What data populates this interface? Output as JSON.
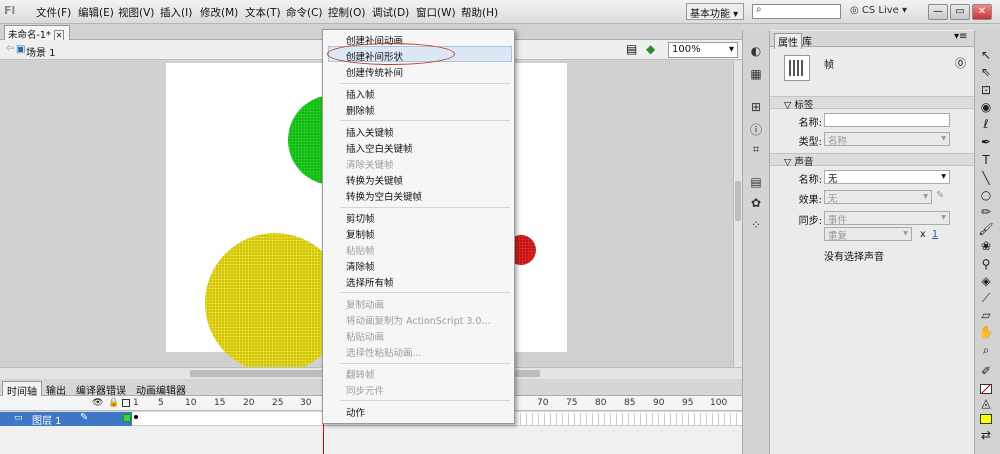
{
  "menubar": {
    "items": [
      "文件(F)",
      "编辑(E)",
      "视图(V)",
      "插入(I)",
      "修改(M)",
      "文本(T)",
      "命令(C)",
      "控制(O)",
      "调试(D)",
      "窗口(W)",
      "帮助(H)"
    ],
    "workspace": "基本功能",
    "cs_live": "CS Live",
    "window_buttons": [
      "—",
      "▭",
      "✕"
    ]
  },
  "document": {
    "tab_title": "未命名-1*",
    "scene": "场景 1",
    "zoom": "100%"
  },
  "context_menu": {
    "items": [
      {
        "label": "创建补间动画",
        "enabled": true
      },
      {
        "label": "创建补间形状",
        "enabled": true,
        "highlighted": true
      },
      {
        "label": "创建传统补间",
        "enabled": true
      },
      {
        "label": "插入帧",
        "enabled": true
      },
      {
        "label": "删除帧",
        "enabled": true
      },
      {
        "label": "插入关键帧",
        "enabled": true
      },
      {
        "label": "插入空白关键帧",
        "enabled": true
      },
      {
        "label": "清除关键帧",
        "enabled": false
      },
      {
        "label": "转换为关键帧",
        "enabled": true
      },
      {
        "label": "转换为空白关键帧",
        "enabled": true
      },
      {
        "label": "剪切帧",
        "enabled": true
      },
      {
        "label": "复制帧",
        "enabled": true
      },
      {
        "label": "粘贴帧",
        "enabled": false
      },
      {
        "label": "清除帧",
        "enabled": true
      },
      {
        "label": "选择所有帧",
        "enabled": true
      },
      {
        "label": "复制动画",
        "enabled": false
      },
      {
        "label": "将动画复制为 ActionScript 3.0...",
        "enabled": false
      },
      {
        "label": "粘贴动画",
        "enabled": false
      },
      {
        "label": "选择性粘贴动画...",
        "enabled": false
      },
      {
        "label": "翻转帧",
        "enabled": false
      },
      {
        "label": "同步元件",
        "enabled": false
      },
      {
        "label": "动作",
        "enabled": true
      }
    ]
  },
  "timeline": {
    "tabs": [
      "时间轴",
      "输出",
      "编译器错误",
      "动画编辑器"
    ],
    "frame_ticks": [
      "1",
      "5",
      "10",
      "15",
      "20",
      "25",
      "30",
      "70",
      "75",
      "80",
      "85",
      "90",
      "95",
      "100"
    ],
    "layer_name": "图层 1"
  },
  "properties": {
    "tabs": [
      "属性",
      "库"
    ],
    "object_type": "帧",
    "label_section": "标签",
    "name_label": "名称:",
    "name_value": "",
    "type_label": "类型:",
    "type_value": "名称",
    "sound_section": "声音",
    "sound_name_label": "名称:",
    "sound_name_value": "无",
    "effect_label": "效果:",
    "effect_value": "无",
    "sync_label": "同步:",
    "sync_value": "事件",
    "repeat_value": "重复",
    "repeat_x": "x",
    "repeat_count": "1",
    "no_sound": "没有选择声音"
  },
  "stage_shapes": [
    {
      "name": "green-circle",
      "color": "#22cc22"
    },
    {
      "name": "yellow-circle",
      "color": "#e6dc1e"
    },
    {
      "name": "red-circle",
      "color": "#dd2222"
    }
  ]
}
